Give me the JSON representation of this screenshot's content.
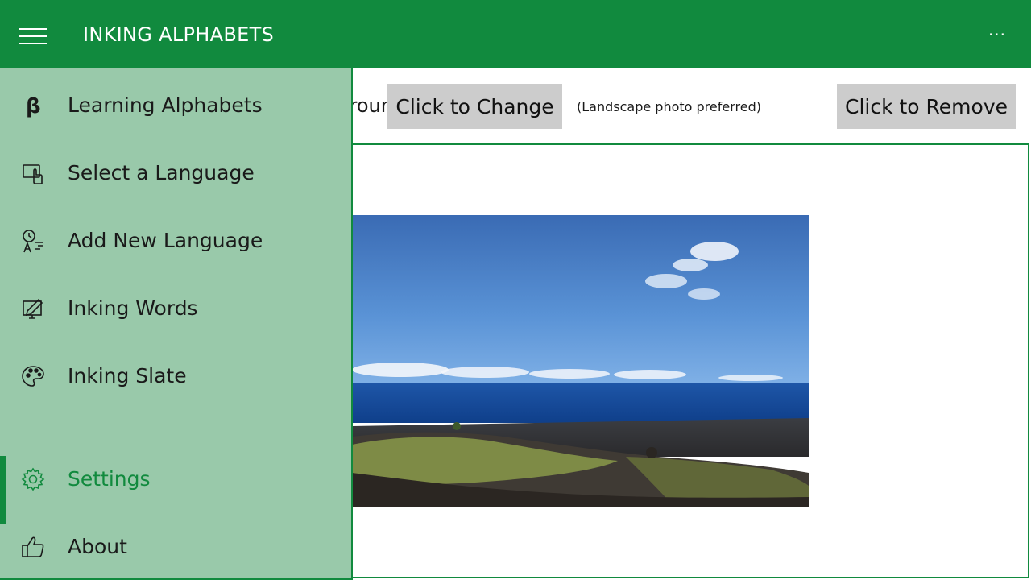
{
  "app": {
    "title": "INKING ALPHABETS"
  },
  "header": {
    "more_label": "···"
  },
  "content": {
    "background_label": "Background Image",
    "change_button": "Click to Change",
    "hint": "(Landscape photo preferred)",
    "remove_button": "Click to Remove"
  },
  "nav": {
    "items": [
      {
        "label": "Learning Alphabets",
        "icon": "beta-icon"
      },
      {
        "label": "Select a Language",
        "icon": "select-language-icon"
      },
      {
        "label": "Add New Language",
        "icon": "add-language-icon"
      },
      {
        "label": "Inking Words",
        "icon": "inking-words-icon"
      },
      {
        "label": "Inking Slate",
        "icon": "palette-icon"
      }
    ],
    "settings": {
      "label": "Settings",
      "icon": "gear-icon"
    },
    "about": {
      "label": "About",
      "icon": "thumbs-up-icon"
    }
  },
  "colors": {
    "accent": "#118a3e",
    "pane": "#99c9aa",
    "button": "#cccccc"
  }
}
